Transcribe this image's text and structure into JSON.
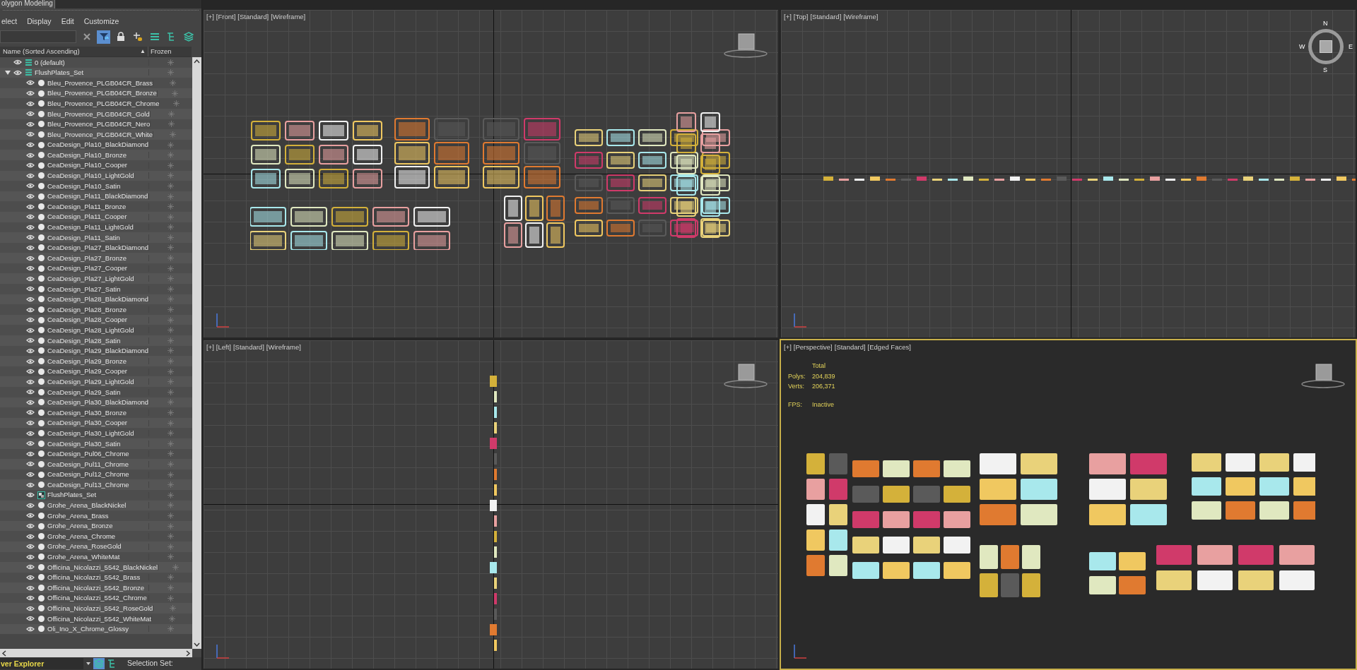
{
  "ribbon_tab": "olygon Modeling",
  "menu": [
    "elect",
    "Display",
    "Edit",
    "Customize"
  ],
  "toolbar": [
    {
      "kind": "clear",
      "on": false
    },
    {
      "kind": "filter",
      "on": true
    },
    {
      "kind": "lock",
      "on": false
    },
    {
      "kind": "add",
      "on": false
    },
    {
      "kind": "stack",
      "on": false
    },
    {
      "kind": "hierarchy",
      "on": false
    },
    {
      "kind": "layers",
      "on": false
    }
  ],
  "columns": {
    "name": "Name (Sorted Ascending)",
    "sort": "▲",
    "frozen": "Frozen"
  },
  "tree": [
    {
      "name": "0 (default)",
      "kind": "layer"
    },
    {
      "name": "FlushPlates_Set",
      "kind": "layer",
      "expanded": true,
      "children": [
        {
          "name": "Bleu_Provence_PLGB04CR_Brass",
          "kind": "object"
        },
        {
          "name": "Bleu_Provence_PLGB04CR_Bronze",
          "kind": "object"
        },
        {
          "name": "Bleu_Provence_PLGB04CR_Chrome",
          "kind": "object"
        },
        {
          "name": "Bleu_Provence_PLGB04CR_Gold",
          "kind": "object"
        },
        {
          "name": "Bleu_Provence_PLGB04CR_Nero",
          "kind": "object"
        },
        {
          "name": "Bleu_Provence_PLGB04CR_White",
          "kind": "object"
        },
        {
          "name": "CeaDesign_Pla10_BlackDiamond",
          "kind": "object"
        },
        {
          "name": "CeaDesign_Pla10_Bronze",
          "kind": "object"
        },
        {
          "name": "CeaDesign_Pla10_Cooper",
          "kind": "object"
        },
        {
          "name": "CeaDesign_Pla10_LightGold",
          "kind": "object"
        },
        {
          "name": "CeaDesign_Pla10_Satin",
          "kind": "object"
        },
        {
          "name": "CeaDesign_Pla11_BlackDiamond",
          "kind": "object"
        },
        {
          "name": "CeaDesign_Pla11_Bronze",
          "kind": "object"
        },
        {
          "name": "CeaDesign_Pla11_Cooper",
          "kind": "object"
        },
        {
          "name": "CeaDesign_Pla11_LightGold",
          "kind": "object"
        },
        {
          "name": "CeaDesign_Pla11_Satin",
          "kind": "object"
        },
        {
          "name": "CeaDesign_Pla27_BlackDiamond",
          "kind": "object"
        },
        {
          "name": "CeaDesign_Pla27_Bronze",
          "kind": "object"
        },
        {
          "name": "CeaDesign_Pla27_Cooper",
          "kind": "object"
        },
        {
          "name": "CeaDesign_Pla27_LightGold",
          "kind": "object"
        },
        {
          "name": "CeaDesign_Pla27_Satin",
          "kind": "object"
        },
        {
          "name": "CeaDesign_Pla28_BlackDiamond",
          "kind": "object"
        },
        {
          "name": "CeaDesign_Pla28_Bronze",
          "kind": "object"
        },
        {
          "name": "CeaDesign_Pla28_Cooper",
          "kind": "object"
        },
        {
          "name": "CeaDesign_Pla28_LightGold",
          "kind": "object"
        },
        {
          "name": "CeaDesign_Pla28_Satin",
          "kind": "object"
        },
        {
          "name": "CeaDesign_Pla29_BlackDiamond",
          "kind": "object"
        },
        {
          "name": "CeaDesign_Pla29_Bronze",
          "kind": "object"
        },
        {
          "name": "CeaDesign_Pla29_Cooper",
          "kind": "object"
        },
        {
          "name": "CeaDesign_Pla29_LightGold",
          "kind": "object"
        },
        {
          "name": "CeaDesign_Pla29_Satin",
          "kind": "object"
        },
        {
          "name": "CeaDesign_Pla30_BlackDiamond",
          "kind": "object"
        },
        {
          "name": "CeaDesign_Pla30_Bronze",
          "kind": "object"
        },
        {
          "name": "CeaDesign_Pla30_Cooper",
          "kind": "object"
        },
        {
          "name": "CeaDesign_Pla30_LightGold",
          "kind": "object"
        },
        {
          "name": "CeaDesign_Pla30_Satin",
          "kind": "object"
        },
        {
          "name": "CeaDesign_Pul06_Chrome",
          "kind": "object"
        },
        {
          "name": "CeaDesign_Pul11_Chrome",
          "kind": "object"
        },
        {
          "name": "CeaDesign_Pul12_Chrome",
          "kind": "object"
        },
        {
          "name": "CeaDesign_Pul13_Chrome",
          "kind": "object"
        },
        {
          "name": "FlushPlates_Set",
          "kind": "group"
        },
        {
          "name": "Grohe_Arena_BlackNickel",
          "kind": "object"
        },
        {
          "name": "Grohe_Arena_Brass",
          "kind": "object"
        },
        {
          "name": "Grohe_Arena_Bronze",
          "kind": "object"
        },
        {
          "name": "Grohe_Arena_Chrome",
          "kind": "object"
        },
        {
          "name": "Grohe_Arena_RoseGold",
          "kind": "object"
        },
        {
          "name": "Grohe_Arena_WhiteMat",
          "kind": "object"
        },
        {
          "name": "Officina_Nicolazzi_5542_BlackNickel",
          "kind": "object"
        },
        {
          "name": "Officina_Nicolazzi_5542_Brass",
          "kind": "object"
        },
        {
          "name": "Officina_Nicolazzi_5542_Bronze",
          "kind": "object"
        },
        {
          "name": "Officina_Nicolazzi_5542_Chrome",
          "kind": "object"
        },
        {
          "name": "Officina_Nicolazzi_5542_RoseGold",
          "kind": "object"
        },
        {
          "name": "Officina_Nicolazzi_5542_WhiteMat",
          "kind": "object"
        },
        {
          "name": "Oli_Ino_X_Chrome_Glossy",
          "kind": "object"
        }
      ]
    }
  ],
  "bottom_bar": {
    "explorer": "ver Explorer",
    "selection_set": "Selection Set:"
  },
  "viewports": [
    {
      "kind": "front",
      "label": [
        "[+]",
        "[Front]",
        "[Standard]",
        "[Wireframe]"
      ],
      "active": false
    },
    {
      "kind": "top",
      "label": [
        "[+]",
        "[Top]",
        "[Standard]",
        "[Wireframe]"
      ],
      "active": false,
      "compass": [
        "N",
        "E",
        "S",
        "W"
      ]
    },
    {
      "kind": "left",
      "label": [
        "[+]",
        "[Left]",
        "[Standard]",
        "[Wireframe]"
      ],
      "active": false
    },
    {
      "kind": "perspective",
      "label": [
        "[+]",
        "[Perspective]",
        "[Standard]",
        "[Edged Faces]"
      ],
      "active": true,
      "stats": {
        "header": "Total",
        "rows": [
          {
            "label": "Polys:",
            "value": "204,839"
          },
          {
            "label": "Verts:",
            "value": "206,371"
          }
        ],
        "fps_label": "FPS:",
        "fps_value": "Inactive"
      }
    }
  ]
}
